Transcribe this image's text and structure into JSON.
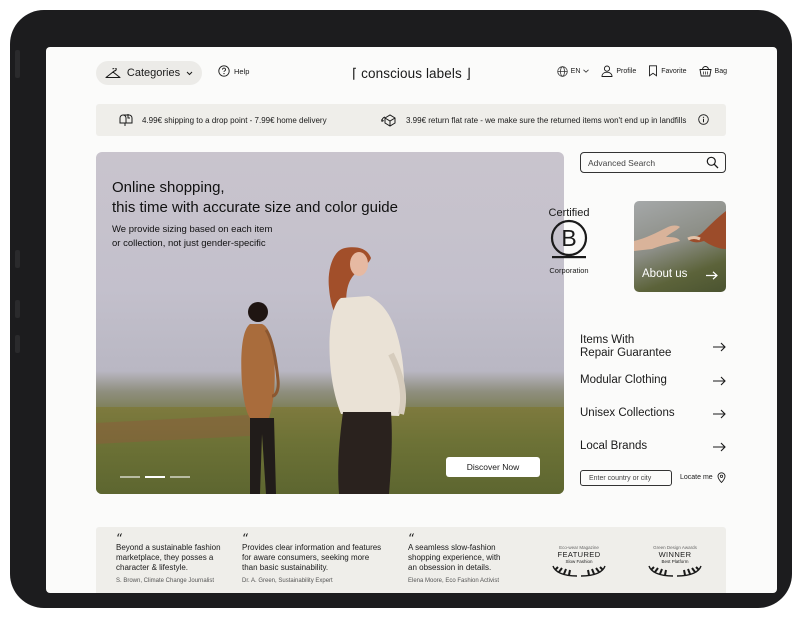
{
  "header": {
    "categories_label": "Categories",
    "help_label": "Help",
    "logo": "⌈ conscious labels ⌋",
    "language": "EN",
    "profile_label": "Profile",
    "favorite_label": "Favorite",
    "bag_label": "Bag"
  },
  "infobar": {
    "shipping_text": "4.99€ shipping to a drop point - 7.99€ home delivery",
    "return_text": "3.99€ return flat rate - we make sure the returned items won't end up in landfills"
  },
  "hero": {
    "title_line1": "Online shopping,",
    "title_line2": "this time with accurate size and color guide",
    "subtitle_line1": "We provide sizing based on each item",
    "subtitle_line2": "or collection, not just gender-specific",
    "cta_label": "Discover Now",
    "active_slide": 2,
    "slide_count": 3
  },
  "search": {
    "placeholder": "Advanced Search"
  },
  "certification": {
    "top": "Certified",
    "letter": "B",
    "bottom": "Corporation"
  },
  "about": {
    "label": "About us"
  },
  "links": [
    {
      "line1": "Items With",
      "line2": "Repair Guarantee"
    },
    {
      "line1": "Modular Clothing"
    },
    {
      "line1": "Unisex Collections"
    },
    {
      "line1": "Local Brands"
    }
  ],
  "location": {
    "placeholder": "Enter country or city",
    "locate_label": "Locate me"
  },
  "testimonials": [
    {
      "line1": "Beyond a sustainable fashion",
      "line2": "marketplace, they posses a",
      "line3": "character & lifestyle.",
      "author": "S. Brown, Climate Change Journalist"
    },
    {
      "line1": "Provides clear information and  features",
      "line2": "for aware consumers, seeking more",
      "line3": "than basic sustainability.",
      "author": "Dr. A. Green, Sustainability Expert"
    },
    {
      "line1": "A seamless slow-fashion",
      "line2": "shopping experience, with",
      "line3": "an obsession in details.",
      "author": "Elena Moore, Eco Fashion Activist"
    }
  ],
  "awards": [
    {
      "source": "Eco-wear Magazine",
      "title": "FEATURED",
      "subtitle": "Slow Fashion"
    },
    {
      "source": "Green Design Awards",
      "title": "WINNER",
      "subtitle": "Best Platform"
    }
  ],
  "colors": {
    "panel": "#efeeea",
    "screen": "#fbfbfa",
    "frame": "#1c1c1e",
    "text": "#1a1a1a"
  }
}
